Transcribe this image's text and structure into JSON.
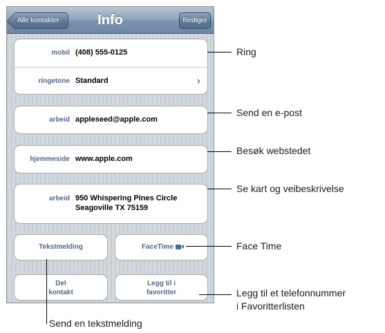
{
  "nav": {
    "title": "Info",
    "back_label": "Alle kontakter",
    "edit_label": "Rediger"
  },
  "fields": {
    "phone": {
      "label": "mobil",
      "value": "(408) 555-0125"
    },
    "ringtone": {
      "label": "ringetone",
      "value": "Standard"
    },
    "email": {
      "label": "arbeid",
      "value": "appleseed@apple.com"
    },
    "homepage": {
      "label": "hjemmeside",
      "value": "www.apple.com"
    },
    "address": {
      "label": "arbeid",
      "line1": "950 Whispering Pines Circle",
      "line2": "Seagoville TX 75159"
    }
  },
  "buttons": {
    "text_message": "Tekstmelding",
    "facetime": "FaceTime",
    "share_line1": "Del",
    "share_line2": "kontakt",
    "favorites_line1": "Legg til i",
    "favorites_line2": "favoritter"
  },
  "callouts": {
    "call": "Ring",
    "email": "Send en e-post",
    "web": "Besøk webstedet",
    "map": "Se kart og veibeskrivelse",
    "facetime": "Face Time",
    "favorites_line1": "Legg til et telefonnummer",
    "favorites_line2": "i Favoritterlisten",
    "text": "Send en tekstmelding"
  },
  "icons": {
    "chevron": "chevron-right-icon",
    "facetime": "video-camera-icon"
  }
}
